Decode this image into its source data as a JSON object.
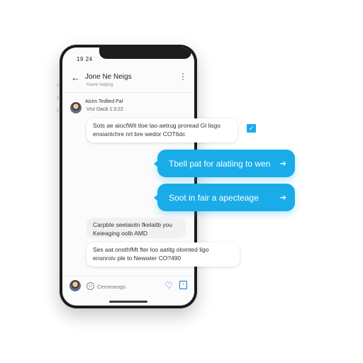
{
  "status_bar": {
    "time": "19 24"
  },
  "header": {
    "contact_name": "Jone Ne Neigs",
    "contact_subtitle": "Kaore Vaiging",
    "back_icon": "arrow-left-icon",
    "more_icon": "more-vertical-icon"
  },
  "thread": {
    "sender_name": "Aicim Tedlied Pal",
    "sender_meta": "Vnz Dacb 1:3:22",
    "messages": [
      {
        "direction": "incoming",
        "lines": [
          "Sots ae aiocfWit tloe lao aetrug proread Gl lisgo",
          "ensiantchre nrt bre wedor COT6dc"
        ]
      },
      {
        "direction": "outgoing",
        "text": "Tbell pat for alatiing to wen"
      },
      {
        "direction": "outgoing",
        "text": "Soot in fair a apecteage"
      },
      {
        "direction": "incoming",
        "lines": [
          "Carpbte seelaiotn fkelaitb you",
          "Keieaging oolb AMD"
        ]
      },
      {
        "direction": "incoming",
        "lines": [
          "Ses aat onsthfMt fter loo aatitg olomted ligo",
          "ensnroiv ple to Newwier CO?490"
        ]
      }
    ],
    "accent_color": "#1aace9"
  },
  "composer": {
    "placeholder": "Cemeseags",
    "heart_icon": "heart-icon",
    "send_icon": "send-icon"
  }
}
